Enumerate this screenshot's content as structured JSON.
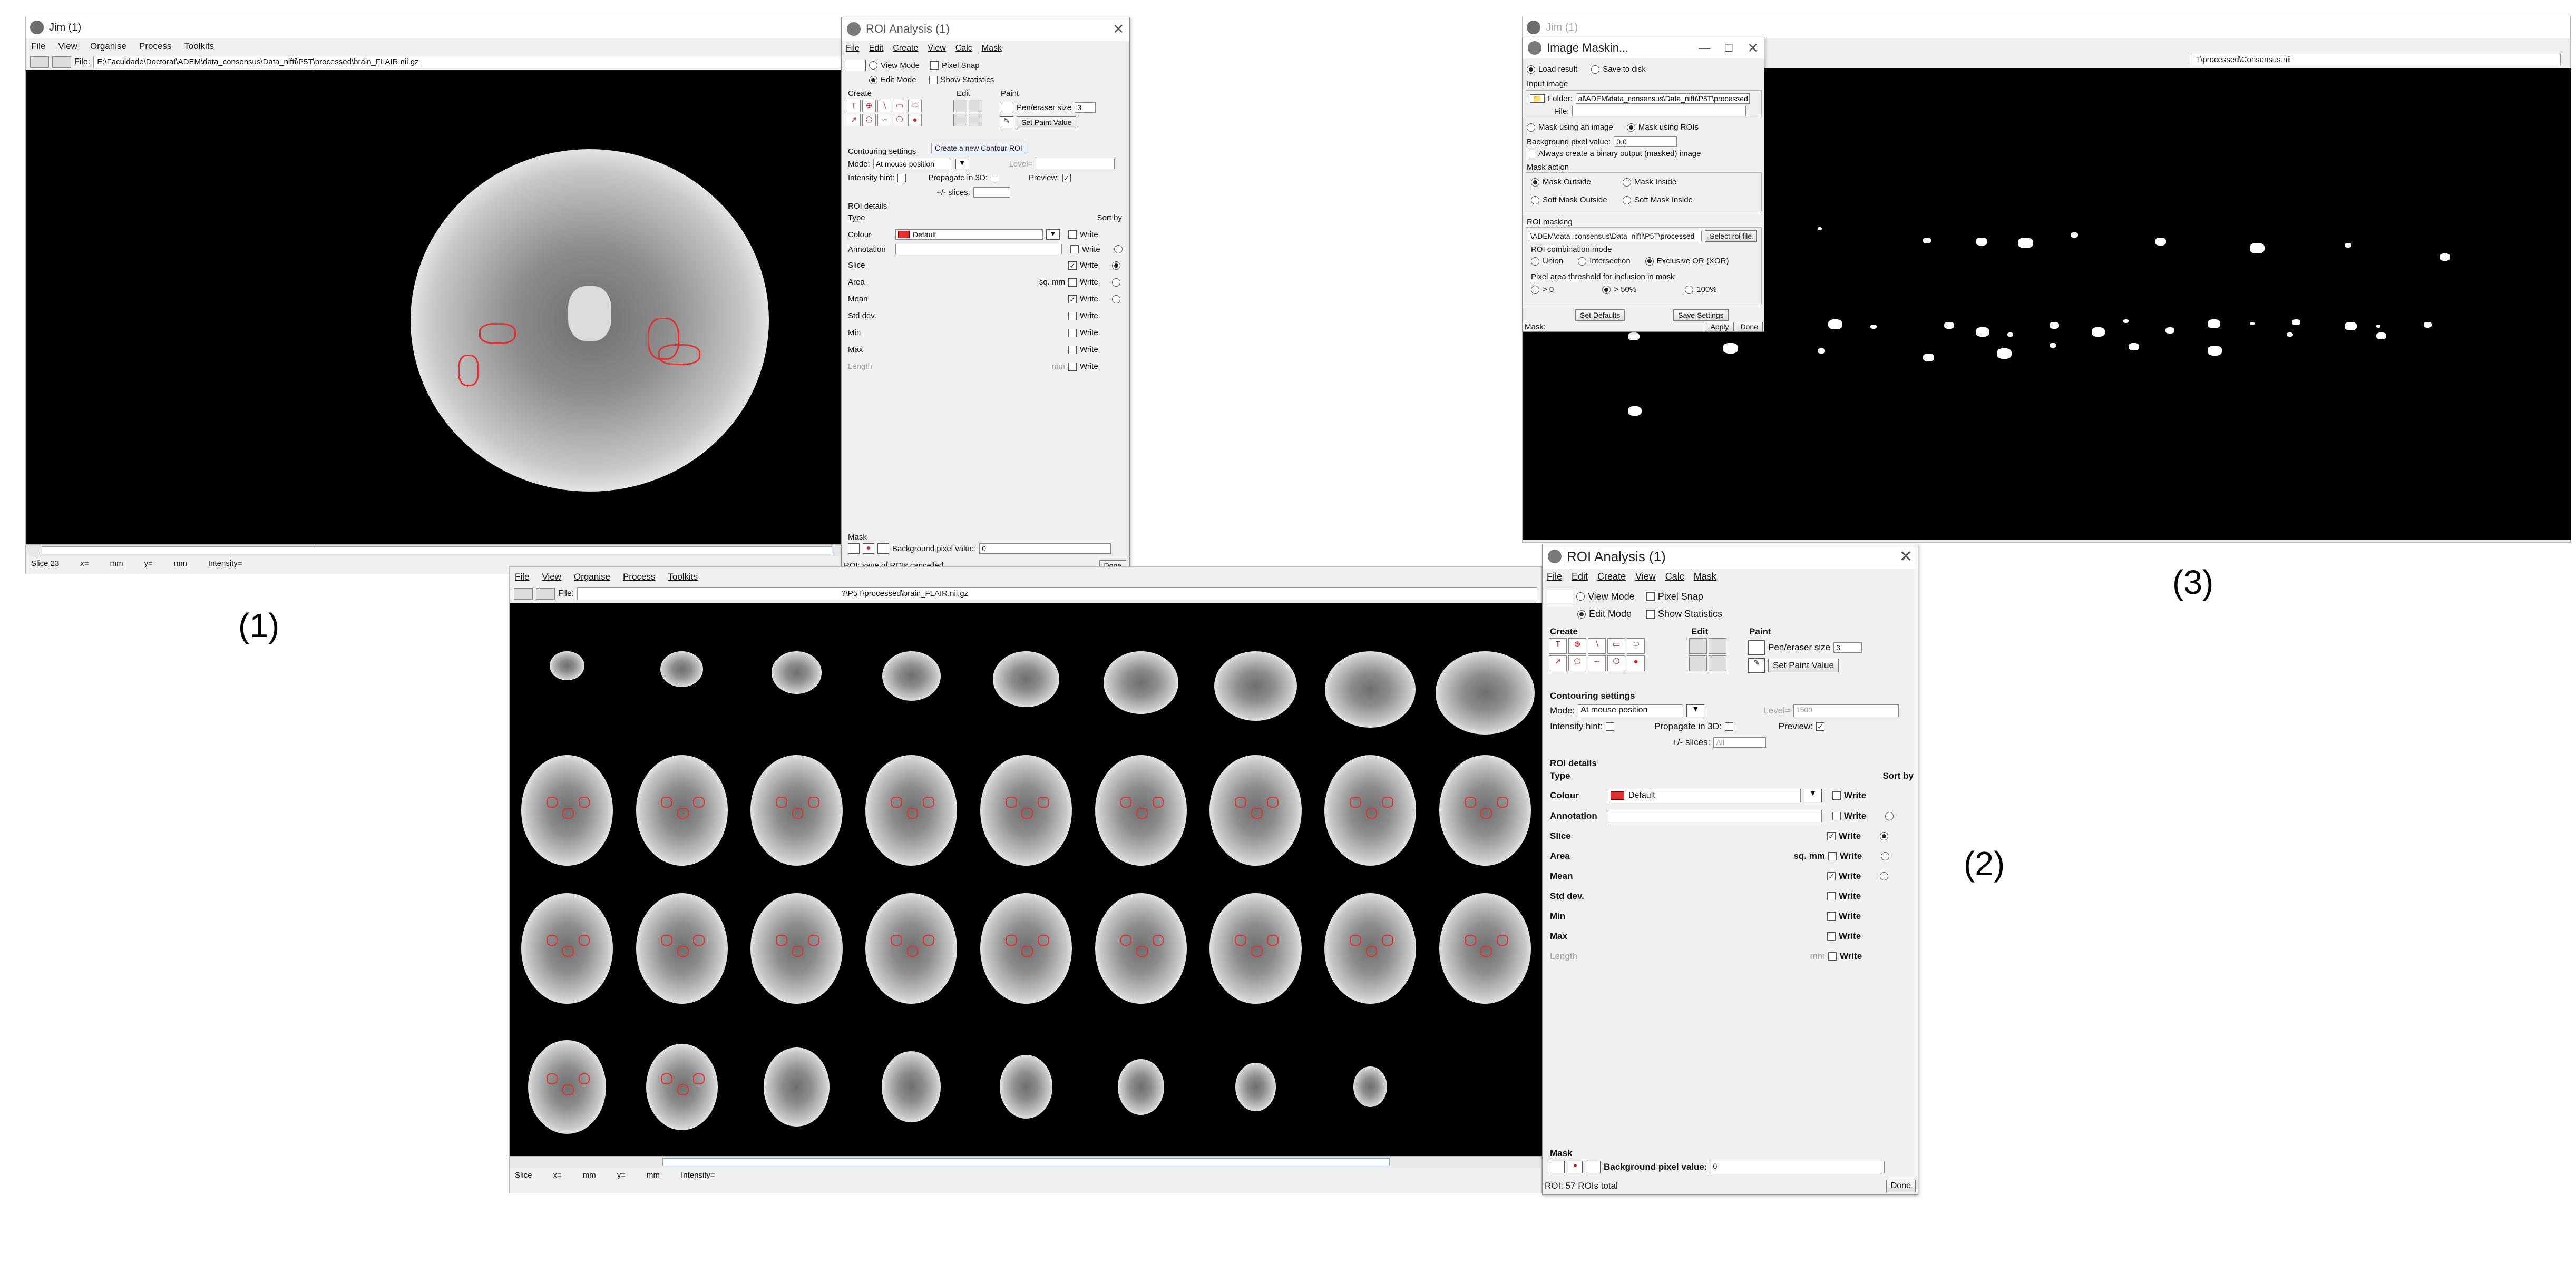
{
  "labels": {
    "p1": "(1)",
    "p2": "(2)",
    "p3": "(3)"
  },
  "jim1": {
    "title": "Jim (1)",
    "menu": [
      "File",
      "View",
      "Organise",
      "Process",
      "Toolkits"
    ],
    "file_label": "File:",
    "file_path": "E:\\Faculdade\\Doctorat\\ADEM\\data_consensus\\Data_nifti\\P5T\\processed\\brain_FLAIR.nii.gz",
    "status": {
      "slice": "Slice 23",
      "x": "x=",
      "mm1": "mm",
      "y": "y=",
      "mm2": "mm",
      "intensity": "Intensity="
    }
  },
  "jim2": {
    "menu": [
      "File",
      "View",
      "Organise",
      "Process",
      "Toolkits"
    ],
    "file_label": "File:",
    "file_path": "?\\P5T\\processed\\brain_FLAIR.nii.gz",
    "status": {
      "slice": "Slice",
      "x": "x=",
      "mm1": "mm",
      "y": "y=",
      "mm2": "mm",
      "intensity": "Intensity="
    }
  },
  "jim3": {
    "title": "Jim (1)",
    "file_path": "T\\processed\\Consensus.nii"
  },
  "roi_small": {
    "title": "ROI Analysis (1)",
    "menu": [
      "File",
      "Edit",
      "Create",
      "View",
      "Calc",
      "Mask"
    ],
    "view_mode": "View Mode",
    "pixel_snap": "Pixel Snap",
    "edit_mode": "Edit Mode",
    "show_stats": "Show Statistics",
    "create": "Create",
    "edit": "Edit",
    "paint": "Paint",
    "pen_size_label": "Pen/eraser size",
    "pen_size": "3",
    "set_paint": "Set Paint Value",
    "tooltip": "Create a new Contour ROI",
    "contouring": "Contouring settings",
    "mode_label": "Mode:",
    "mode_value": "At mouse position",
    "level_label": "Level=",
    "intensity_hint": "Intensity hint:",
    "propagate": "Propagate in 3D:",
    "preview": "Preview:",
    "slices": "+/- slices:",
    "details": "ROI details",
    "type": "Type",
    "sort_by": "Sort by",
    "colour": "Colour",
    "colour_value": "Default",
    "annotation": "Annotation",
    "slice": "Slice",
    "area": "Area",
    "area_unit": "sq. mm",
    "mean": "Mean",
    "std": "Std dev.",
    "min": "Min",
    "max": "Max",
    "length": "Length",
    "length_unit": "mm",
    "write": "Write",
    "mask": "Mask",
    "bg_pixel": "Background pixel value:",
    "bg_value": "0",
    "status": "ROI: save of ROIs cancelled.",
    "done": "Done"
  },
  "roi_big": {
    "title": "ROI Analysis (1)",
    "menu": [
      "File",
      "Edit",
      "Create",
      "View",
      "Calc",
      "Mask"
    ],
    "view_mode": "View Mode",
    "pixel_snap": "Pixel Snap",
    "edit_mode": "Edit Mode",
    "show_stats": "Show Statistics",
    "create": "Create",
    "edit": "Edit",
    "paint": "Paint",
    "pen_size_label": "Pen/eraser size",
    "pen_size": "3",
    "set_paint": "Set Paint Value",
    "contouring": "Contouring settings",
    "mode_label": "Mode:",
    "mode_value": "At mouse position",
    "level_label": "Level=",
    "level_value": "1500",
    "intensity_hint": "Intensity hint:",
    "propagate": "Propagate in 3D:",
    "preview": "Preview:",
    "slices": "+/- slices:",
    "slices_value": "All",
    "details": "ROI details",
    "type": "Type",
    "sort_by": "Sort by",
    "colour": "Colour",
    "colour_value": "Default",
    "annotation": "Annotation",
    "slice": "Slice",
    "area": "Area",
    "area_unit": "sq. mm",
    "mean": "Mean",
    "std": "Std dev.",
    "min": "Min",
    "max": "Max",
    "length": "Length",
    "length_unit": "mm",
    "write": "Write",
    "mask": "Mask",
    "bg_pixel": "Background pixel value:",
    "bg_value": "0",
    "status": "ROI: 57 ROIs total",
    "done": "Done"
  },
  "masking": {
    "title": "Image Maskin...",
    "load_result": "Load result",
    "save_disk": "Save to disk",
    "input_image": "Input image",
    "folder_label": "Folder:",
    "folder_value": "al\\ADEM\\data_consensus\\Data_nifti\\P5T\\processed",
    "file_label": "File:",
    "mask_image": "Mask using an image",
    "mask_rois": "Mask using ROIs",
    "bg_label": "Background pixel value:",
    "bg_value": "0.0",
    "binary": "Always create a binary output (masked) image",
    "mask_action": "Mask action",
    "mask_outside": "Mask Outside",
    "mask_inside": "Mask Inside",
    "soft_outside": "Soft Mask Outside",
    "soft_inside": "Soft Mask Inside",
    "roi_masking": "ROI masking",
    "roi_file": "\\ADEM\\data_consensus\\Data_nifti\\P5T\\processed",
    "select_roi": "Select roi file",
    "combination": "ROI combination mode",
    "union": "Union",
    "intersection": "Intersection",
    "xor": "Exclusive OR (XOR)",
    "threshold": "Pixel area threshold for inclusion in mask",
    "t0": "> 0",
    "t50": "> 50%",
    "t100": "100%",
    "set_defaults": "Set Defaults",
    "save_settings": "Save Settings",
    "status": "Mask:",
    "apply": "Apply",
    "done": "Done"
  },
  "colors": {
    "roi": "#e03030",
    "accent": "#2a6fd6"
  }
}
